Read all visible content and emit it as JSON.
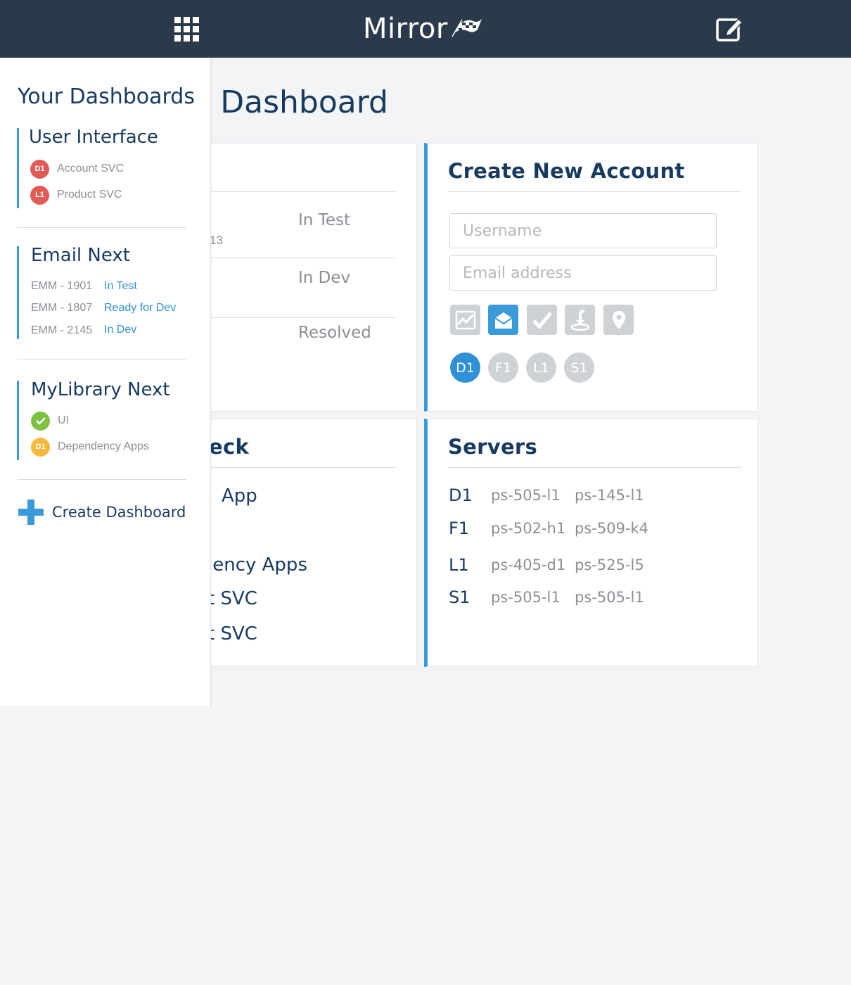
{
  "header": {
    "brand": "Mirror",
    "apps_icon": "grid-icon",
    "edit_icon": "edit-icon"
  },
  "main": {
    "page_title": "Mirror Next Dashboard",
    "page_title_visible": "t Dashboard",
    "card_tickets": {
      "statuses": [
        "In Test",
        "In Dev",
        "Resolved"
      ],
      "fragment_number": "13"
    },
    "card_create_account": {
      "title": "Create New Account",
      "username_placeholder": "Username",
      "email_placeholder": "Email address",
      "icons": [
        "chart-icon",
        "envelope-icon",
        "check-icon",
        "download-icon",
        "map-pin-icon"
      ],
      "active_icon": "envelope-icon",
      "environments": [
        "D1",
        "F1",
        "L1",
        "S1"
      ],
      "active_environment": "D1"
    },
    "card_deploy": {
      "title_fragment": "eck",
      "rows": [
        "App",
        "lency Apps",
        "t SVC",
        "t SVC"
      ]
    },
    "card_servers": {
      "title": "Servers",
      "rows": [
        {
          "env": "D1",
          "hosts": [
            "ps-505-l1",
            "ps-145-l1"
          ]
        },
        {
          "env": "F1",
          "hosts": [
            "ps-502-h1",
            "ps-509-k4"
          ]
        },
        {
          "env": "L1",
          "hosts": [
            "ps-405-d1",
            "ps-525-l5"
          ]
        },
        {
          "env": "S1",
          "hosts": [
            "ps-505-l1",
            "ps-505-l1"
          ]
        }
      ]
    }
  },
  "sidebar": {
    "title": "Your Dashboards",
    "groups": [
      {
        "title": "User Interface",
        "items": [
          {
            "badge": "D1",
            "label": "Account SVC",
            "color": "#e05a56"
          },
          {
            "badge": "L1",
            "label": "Product SVC",
            "color": "#e05a56"
          }
        ]
      },
      {
        "title": "Email Next",
        "tickets": [
          {
            "id": "EMM - 1901",
            "status": "In Test"
          },
          {
            "id": "EMM - 1807",
            "status": "Ready for Dev"
          },
          {
            "id": "EMM - 2145",
            "status": "In Dev"
          }
        ]
      },
      {
        "title": "MyLibrary Next",
        "items": [
          {
            "badge": "check",
            "label": "UI",
            "color": "#7dc242"
          },
          {
            "badge": "D1",
            "label": "Dependency Apps",
            "color": "#f6b93b"
          }
        ]
      }
    ],
    "create_label": "Create Dashboard"
  },
  "colors": {
    "topbar": "#2b3a4b",
    "accent": "#3a9ad9",
    "heading": "#173a5e",
    "muted": "#8a8f96",
    "error": "#e05a56",
    "success": "#7dc242",
    "warning": "#f6b93b"
  }
}
